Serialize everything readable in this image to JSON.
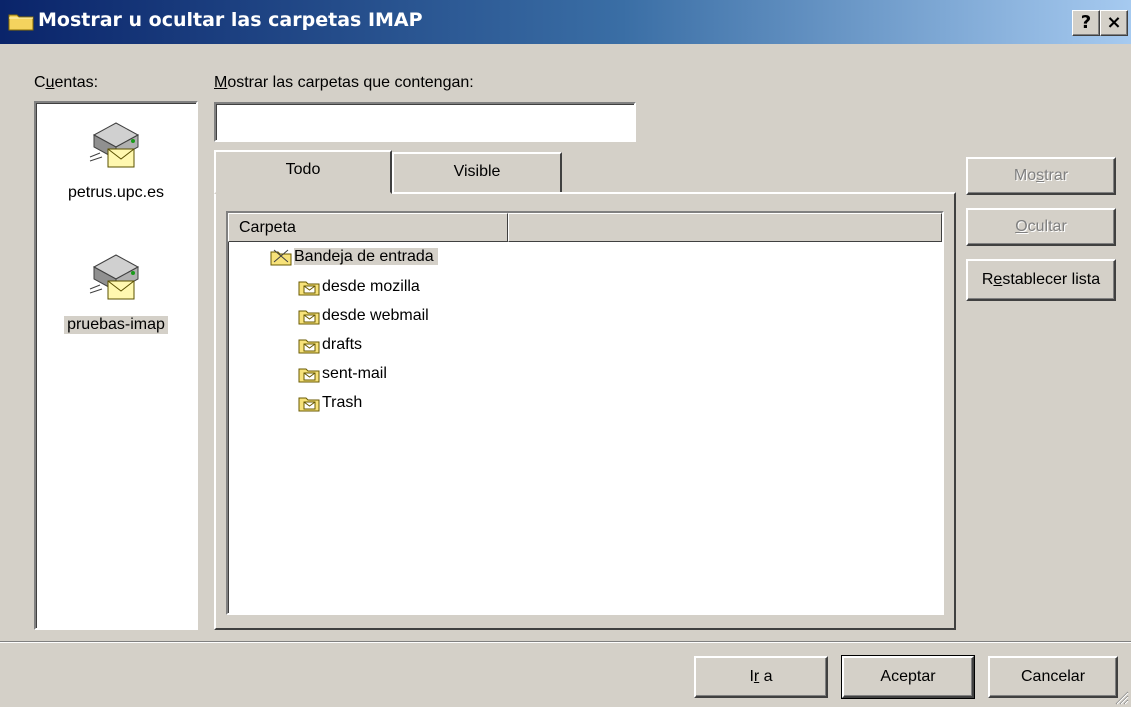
{
  "window": {
    "title": "Mostrar u ocultar las carpetas IMAP",
    "help_label": "?",
    "close_label": "×"
  },
  "accounts": {
    "label_pre": "C",
    "label_acc": "u",
    "label_post": "entas:",
    "items": [
      {
        "name": "petrus.upc.es",
        "icon": "mail-server-icon"
      },
      {
        "name": "pruebas-imap",
        "icon": "mail-server-icon",
        "selected": true
      }
    ]
  },
  "filter": {
    "label_acc": "M",
    "label_post": "ostrar las carpetas que contengan:",
    "value": ""
  },
  "tabs": [
    {
      "label": "Todo",
      "active": true
    },
    {
      "label": "Visible",
      "active": false
    }
  ],
  "folder_list": {
    "column_header": "Carpeta",
    "root": {
      "name": "Bandeja de entrada",
      "icon": "subscribed-folder-icon"
    },
    "children": [
      {
        "name": "desde mozilla",
        "icon": "folder-icon"
      },
      {
        "name": "desde webmail",
        "icon": "folder-icon"
      },
      {
        "name": "drafts",
        "icon": "folder-icon"
      },
      {
        "name": "sent-mail",
        "icon": "folder-icon"
      },
      {
        "name": "Trash",
        "icon": "folder-icon"
      }
    ]
  },
  "side_buttons": {
    "show": {
      "pre": "Mo",
      "acc": "s",
      "post": "trar",
      "enabled": false
    },
    "hide": {
      "pre": "",
      "acc": "O",
      "post": "cultar",
      "enabled": false
    },
    "reset": {
      "pre": "R",
      "acc": "e",
      "post": "stablecer lista",
      "enabled": true
    }
  },
  "footer_buttons": {
    "goto": {
      "pre": "I",
      "acc": "r",
      "post": " a"
    },
    "ok": {
      "label": "Aceptar"
    },
    "cancel": {
      "label": "Cancelar"
    }
  },
  "colors": {
    "face": "#d4d0c8",
    "title_start": "#0a246a",
    "title_end": "#a6caf0"
  }
}
